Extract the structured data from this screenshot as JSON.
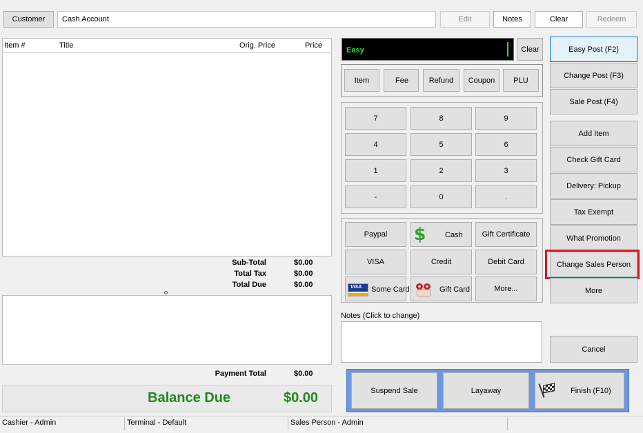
{
  "top_bar": {
    "customer_label": "Customer",
    "customer_value": "Cash Account",
    "edit_label": "Edit",
    "notes_label": "Notes",
    "clear_label": "Clear",
    "redeem_label": "Redeem"
  },
  "items_table": {
    "columns": [
      "Item #",
      "Title",
      "Orig. Price",
      "Price"
    ]
  },
  "totals": {
    "subtotal_label": "Sub-Total",
    "subtotal_value": "$0.00",
    "tax_label": "Total Tax",
    "tax_value": "$0.00",
    "due_label": "Total Due",
    "due_value": "$0.00",
    "payment_total_label": "Payment Total",
    "payment_total_value": "$0.00",
    "balance_due_label": "Balance Due",
    "balance_due_value": "$0.00",
    "balance_color": "#1e8a1e"
  },
  "entry": {
    "mode_text": "Easy",
    "clear_label": "Clear"
  },
  "type_buttons": [
    "Item",
    "Fee",
    "Refund",
    "Coupon",
    "PLU"
  ],
  "keypad": [
    "7",
    "8",
    "9",
    "4",
    "5",
    "6",
    "1",
    "2",
    "3",
    "-",
    "0",
    "."
  ],
  "payments": {
    "paypal": "Paypal",
    "cash": "Cash",
    "gift_certificate": "Gift Certificate",
    "visa": "VISA",
    "credit": "Credit",
    "debit_card": "Debit Card",
    "some_card": "Some Card",
    "visa_logo": "VISA",
    "gift_card": "Gift Card",
    "more": "More..."
  },
  "notes": {
    "label": "Notes (Click to change)"
  },
  "actions": {
    "suspend_sale": "Suspend Sale",
    "layaway": "Layaway",
    "finish": "Finish (F10)"
  },
  "right_panel": {
    "easy_post": "Easy Post (F2)",
    "change_post": "Change Post (F3)",
    "sale_post": "Sale Post (F4)",
    "add_item": "Add Item",
    "check_gift_card": "Check Gift Card",
    "delivery_pickup": "Delivery: Pickup",
    "tax_exempt": "Tax Exempt",
    "what_promotion": "What Promotion",
    "change_sales_person": "Change Sales Person",
    "more": "More",
    "cancel": "Cancel",
    "highlight_color": "#d71920"
  },
  "status_bar": {
    "cashier": "Cashier - Admin",
    "terminal": "Terminal - Default",
    "sales_person": "Sales Person - Admin"
  }
}
